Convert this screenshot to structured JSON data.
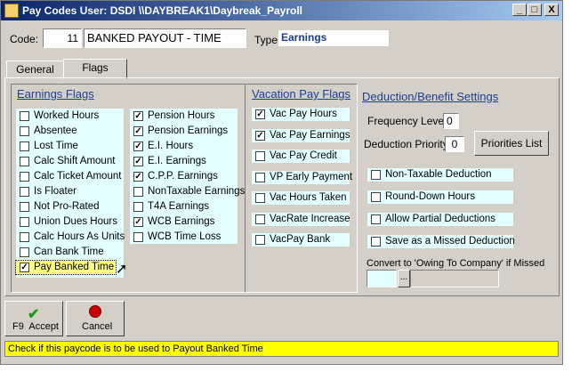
{
  "window": {
    "title": "Pay Codes  User: DSDI  \\\\DAYBREAK1\\Daybreak_Payroll",
    "min_glyph": "_",
    "max_glyph": "□",
    "close_glyph": "X"
  },
  "header": {
    "code_label": "Code:",
    "code_value": "11",
    "description": "BANKED PAYOUT - TIME",
    "type_label": "Type:",
    "type_value": "Earnings"
  },
  "tabs": [
    {
      "label": "General"
    },
    {
      "label": "Flags"
    }
  ],
  "earnings_flags": {
    "title": "Earnings Flags",
    "col1": [
      {
        "label": "Worked Hours",
        "checked": false
      },
      {
        "label": "Absentee",
        "checked": false
      },
      {
        "label": "Lost Time",
        "checked": false
      },
      {
        "label": "Calc Shift Amount",
        "checked": false
      },
      {
        "label": "Calc Ticket Amount",
        "checked": false
      },
      {
        "label": "Is Floater",
        "checked": false
      },
      {
        "label": "Not Pro-Rated",
        "checked": false
      },
      {
        "label": "Union Dues Hours",
        "checked": false
      },
      {
        "label": "Calc Hours As Units",
        "checked": false
      },
      {
        "label": "Can Bank Time",
        "checked": false
      },
      {
        "label": "Pay Banked Time",
        "checked": true
      }
    ],
    "col2": [
      {
        "label": "Pension Hours",
        "checked": true
      },
      {
        "label": "Pension Earnings",
        "checked": true
      },
      {
        "label": "E.I. Hours",
        "checked": true
      },
      {
        "label": "E.I. Earnings",
        "checked": true
      },
      {
        "label": "C.P.P. Earnings",
        "checked": true
      },
      {
        "label": "NonTaxable Earnings",
        "checked": false
      },
      {
        "label": "T4A Earnings",
        "checked": false
      },
      {
        "label": "WCB Earnings",
        "checked": true
      },
      {
        "label": "WCB Time Loss",
        "checked": false
      }
    ]
  },
  "vacation_flags": {
    "title": "Vacation Pay Flags",
    "items": [
      {
        "label": "Vac Pay Hours",
        "checked": true
      },
      {
        "label": "Vac Pay Earnings",
        "checked": true
      },
      {
        "label": "Vac Pay Credit",
        "checked": false
      },
      {
        "label": "VP Early Payment",
        "checked": false
      },
      {
        "label": "Vac Hours Taken",
        "checked": false
      },
      {
        "label": "VacRate Increase",
        "checked": false
      },
      {
        "label": "VacPay Bank",
        "checked": false
      }
    ]
  },
  "deduction": {
    "title": "Deduction/Benefit Settings",
    "frequency_label": "Frequency Level",
    "frequency_value": "0",
    "priority_label": "Deduction Priority",
    "priority_value": "0",
    "priorities_button": "Priorities List",
    "items": [
      {
        "label": "Non-Taxable Deduction",
        "checked": false
      },
      {
        "label": "Round-Down Hours",
        "checked": false
      },
      {
        "label": "Allow Partial Deductions",
        "checked": false
      },
      {
        "label": "Save as a Missed Deduction",
        "checked": false
      }
    ],
    "convert_label": "Convert to 'Owing To Company' if Missed",
    "convert_button": "..."
  },
  "buttons": {
    "accept_key": "F9",
    "accept_label": "Accept",
    "cancel_label": "Cancel"
  },
  "status": "Check if this paycode is to be used to Payout Banked Time",
  "colors": {
    "checkbox_bg": "#e3ffff",
    "highlight": "#ffff80",
    "status_bg": "#ffff00",
    "heading": "#1c3f94"
  }
}
